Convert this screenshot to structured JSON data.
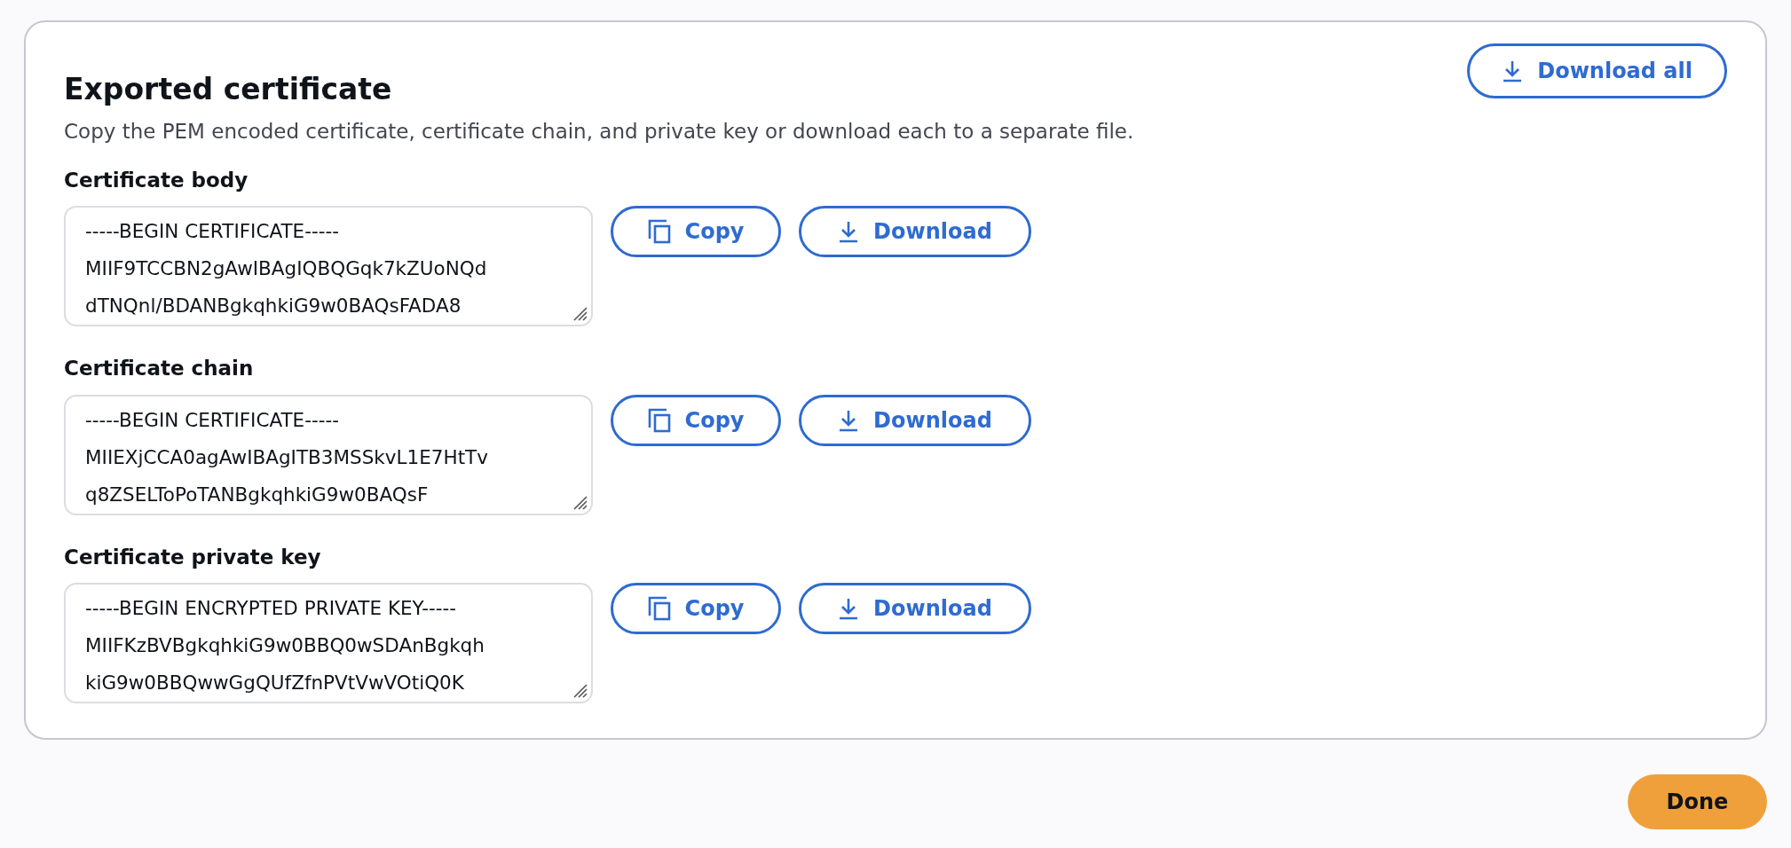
{
  "panel": {
    "title": "Exported certificate",
    "description": "Copy the PEM encoded certificate, certificate chain, and private key or download each to a separate file.",
    "download_all": "Download all",
    "fields": [
      {
        "label": "Certificate body",
        "lines": [
          "-----BEGIN CERTIFICATE-----",
          "MIIF9TCCBN2gAwIBAgIQBQGqk7kZUoNQd",
          "dTNQnl/BDANBgkqhkiG9w0BAQsFADA8"
        ],
        "copy": "Copy",
        "download": "Download"
      },
      {
        "label": "Certificate chain",
        "lines": [
          "-----BEGIN CERTIFICATE-----",
          "MIIEXjCCA0agAwIBAgITB3MSSkvL1E7HtTv",
          "q8ZSELToPoTANBgkqhkiG9w0BAQsF"
        ],
        "copy": "Copy",
        "download": "Download"
      },
      {
        "label": "Certificate private key",
        "lines": [
          "-----BEGIN ENCRYPTED PRIVATE KEY-----",
          "MIIFKzBVBgkqhkiG9w0BBQ0wSDAnBgkqh",
          "kiG9w0BBQwwGgQUfZfnPVtVwVOtiQ0K"
        ],
        "copy": "Copy",
        "download": "Download"
      }
    ]
  },
  "footer": {
    "done": "Done"
  }
}
